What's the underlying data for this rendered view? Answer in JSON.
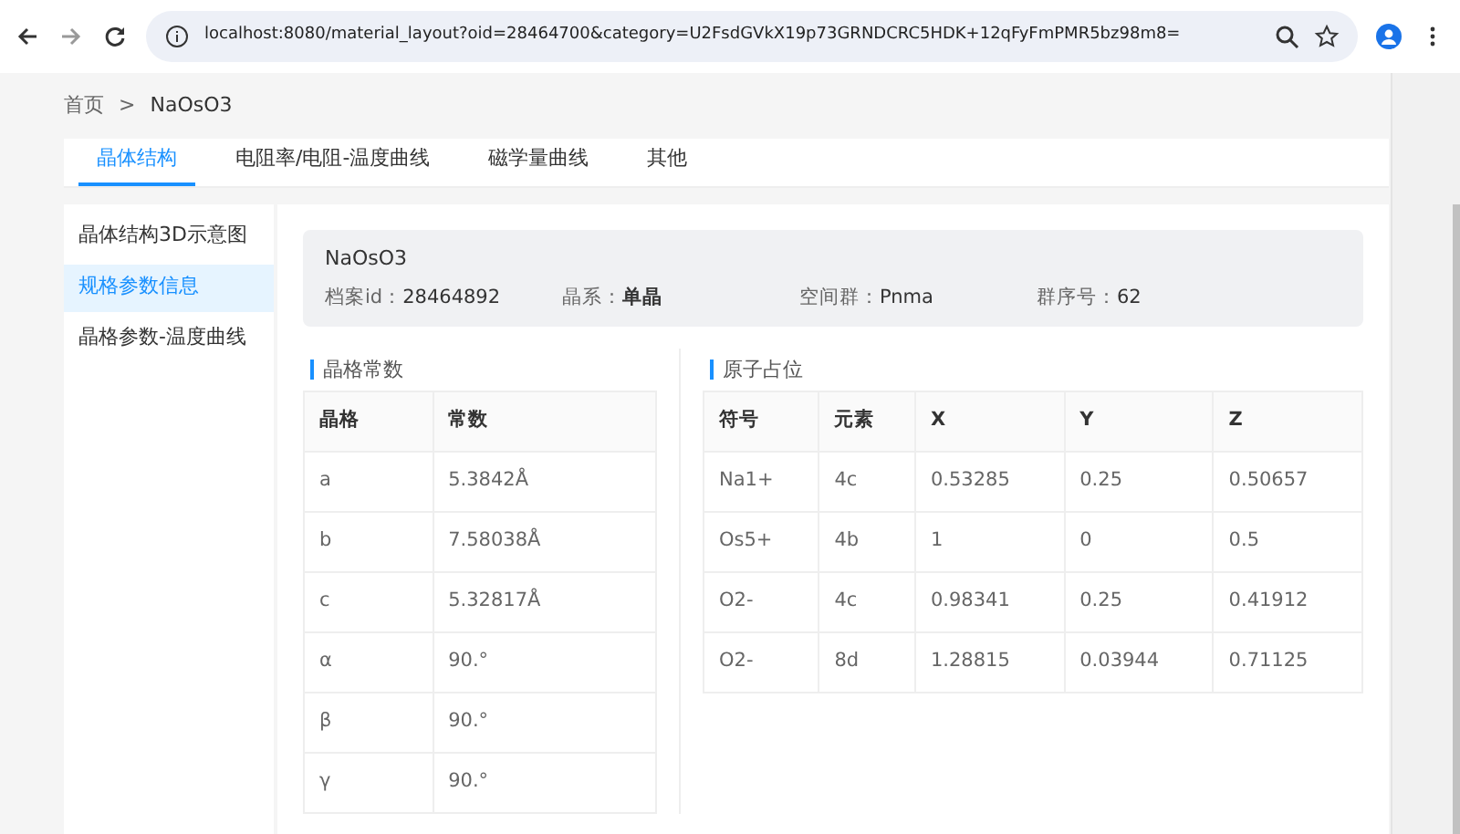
{
  "browser": {
    "url": "localhost:8080/material_layout?oid=28464700&category=U2FsdGVkX19p73GRNDCRC5HDK+12qFyFmPMR5bz98m8="
  },
  "breadcrumb": [
    "首页",
    ">",
    "NaOsO3"
  ],
  "tabs": [
    {
      "label": "晶体结构",
      "selected": true
    },
    {
      "label": "电阻率/电阻-温度曲线",
      "selected": false
    },
    {
      "label": "磁学量曲线",
      "selected": false
    },
    {
      "label": "其他",
      "selected": false
    }
  ],
  "sidebar": {
    "items": [
      {
        "label": "晶体结构3D示意图",
        "selected": false
      },
      {
        "label": "规格参数信息",
        "selected": true
      },
      {
        "label": "晶格参数-温度曲线",
        "selected": false
      }
    ]
  },
  "info": {
    "name": "NaOsO3",
    "fields": [
      {
        "label": "档案id：",
        "value": "28464892",
        "bold": false
      },
      {
        "label": "晶系：",
        "value": "单晶",
        "bold": true
      },
      {
        "label": "空间群：",
        "value": "Pnma",
        "bold": false
      },
      {
        "label": "群序号：",
        "value": "62",
        "bold": false
      }
    ]
  },
  "lattice": {
    "title": "晶格常数",
    "columns": [
      "晶格",
      "常数"
    ],
    "rows": [
      [
        "a",
        "5.3842Å"
      ],
      [
        "b",
        "7.58038Å"
      ],
      [
        "c",
        "5.32817Å"
      ],
      [
        "α",
        "90.°"
      ],
      [
        "β",
        "90.°"
      ],
      [
        "γ",
        "90.°"
      ]
    ]
  },
  "sites": {
    "title": "原子占位",
    "columns": [
      "符号",
      "元素",
      "X",
      "Y",
      "Z"
    ],
    "rows": [
      [
        "Na1+",
        "4c",
        "0.53285",
        "0.25",
        "0.50657"
      ],
      [
        "Os5+",
        "4b",
        "1",
        "0",
        "0.5"
      ],
      [
        "O2-",
        "4c",
        "0.98341",
        "0.25",
        "0.41912"
      ],
      [
        "O2-",
        "8d",
        "1.28815",
        "0.03944",
        "0.71125"
      ]
    ]
  }
}
